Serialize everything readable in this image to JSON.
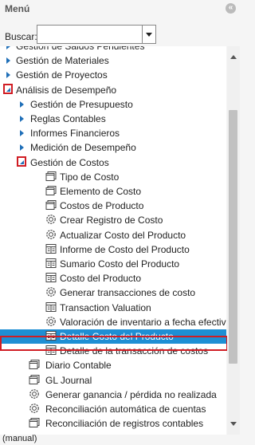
{
  "header": {
    "title": "Menú",
    "collapse_glyph": "«"
  },
  "search": {
    "label": "Buscar:",
    "value": ""
  },
  "tree": {
    "rows": [
      {
        "label": "Gestión de Saldos Pendientes",
        "level": 0,
        "kind": "branch"
      },
      {
        "label": "Gestión de Materiales",
        "level": 0,
        "kind": "branch"
      },
      {
        "label": "Gestión de Proyectos",
        "level": 0,
        "kind": "branch"
      },
      {
        "label": "Análisis de Desempeño",
        "level": 0,
        "kind": "expanded"
      },
      {
        "label": "Gestión de Presupuesto",
        "level": 1,
        "kind": "branch"
      },
      {
        "label": "Reglas Contables",
        "level": 1,
        "kind": "branch"
      },
      {
        "label": "Informes Financieros",
        "level": 1,
        "kind": "branch"
      },
      {
        "label": "Medición de Desempeño",
        "level": 1,
        "kind": "branch"
      },
      {
        "label": "Gestión de Costos",
        "level": 1,
        "kind": "expanded"
      },
      {
        "label": "Tipo de Costo",
        "level": 2,
        "kind": "window"
      },
      {
        "label": "Elemento de Costo",
        "level": 2,
        "kind": "window"
      },
      {
        "label": "Costos de Producto",
        "level": 2,
        "kind": "window"
      },
      {
        "label": "Crear Registro de Costo",
        "level": 2,
        "kind": "process"
      },
      {
        "label": "Actualizar Costo del Producto",
        "level": 2,
        "kind": "process"
      },
      {
        "label": "Informe de Costo del Producto",
        "level": 2,
        "kind": "report"
      },
      {
        "label": "Sumario Costo del Producto",
        "level": 2,
        "kind": "report"
      },
      {
        "label": "Costo del Producto",
        "level": 2,
        "kind": "report"
      },
      {
        "label": "Generar transacciones de costo",
        "level": 2,
        "kind": "process"
      },
      {
        "label": "Transaction Valuation",
        "level": 2,
        "kind": "report"
      },
      {
        "label": "Valoración de inventario a fecha efectiva",
        "level": 2,
        "kind": "process"
      },
      {
        "label": "Detalle Costo del Producto",
        "level": 2,
        "kind": "report",
        "selected": true
      },
      {
        "label": "Detalle de la transacción de costos",
        "level": 2,
        "kind": "report"
      },
      {
        "label": "Diario Contable",
        "level": 1,
        "kind": "window"
      },
      {
        "label": "GL Journal",
        "level": 1,
        "kind": "window"
      },
      {
        "label": "Generar ganancia / pérdida no realizada",
        "level": 1,
        "kind": "process"
      },
      {
        "label": "Reconciliación automática de cuentas",
        "level": 1,
        "kind": "process"
      },
      {
        "label": "Reconciliación de registros contables",
        "level": 1,
        "kind": "window"
      }
    ]
  },
  "footer": {
    "text": "(manual)"
  },
  "colors": {
    "selected": "#1e8fd4",
    "highlight_frame": "#d01d24",
    "arrow": "#1f6fb8"
  }
}
